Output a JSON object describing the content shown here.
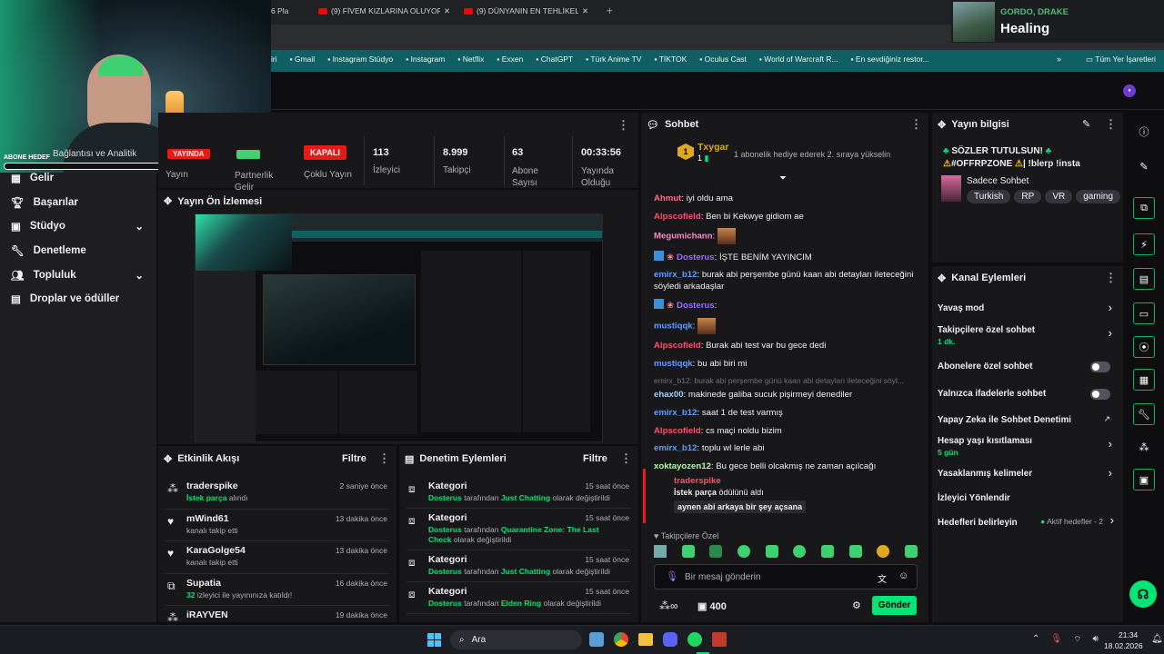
{
  "browser": {
    "tabs": [
      {
        "label": "6 Pla",
        "active": false
      },
      {
        "label": "(9) FİVEM KIZLARINA OLUYOR!",
        "active": false
      },
      {
        "label": "(9) DÜNYANIN EN TEHLİKELİ TE",
        "active": false
      }
    ],
    "bookmarks": [
      "Gmail",
      "Instagram Stüdyo",
      "Instagram",
      "Netflix",
      "Exxen",
      "ChatGPT",
      "Türk Anime TV",
      "TİKTOK",
      "Oculus Cast",
      "World of Warcraft R...",
      "En sevdiğiniz restor..."
    ],
    "bookmarks_truncated_first": "iri",
    "all_bookmarks": "Tüm Yer İşaretleri"
  },
  "music": {
    "artist": "GORDO, DRAKE",
    "title": "Healing"
  },
  "overlay": {
    "label": "ABONE HEDEF",
    "sidebar_partial": "Bağlantısı ve Analitik"
  },
  "sidebar": {
    "items": [
      {
        "label": "Gelir",
        "icon": "money-icon",
        "chevron": false
      },
      {
        "label": "Başarılar",
        "icon": "trophy-icon",
        "chevron": false
      },
      {
        "label": "Stüdyo",
        "icon": "studio-icon",
        "chevron": true
      },
      {
        "label": "Denetleme",
        "icon": "wrench-icon",
        "chevron": false
      },
      {
        "label": "Topluluk",
        "icon": "people-icon",
        "chevron": true
      },
      {
        "label": "Droplar ve ödüller",
        "icon": "gift-icon",
        "chevron": false
      }
    ]
  },
  "stats": {
    "labels": {
      "live": "Yayın",
      "partner": "Partnerlik Gelir",
      "multi": "Çoklu Yayın",
      "viewers": "İzleyici",
      "followers": "Takipçi",
      "subs": "Abone Sayısı",
      "uptime": "Yayında Olduğu"
    },
    "multi_badge": "KAPALI",
    "live_badge": "YAYINDA",
    "viewers": "113",
    "followers": "8.999",
    "subs": "63",
    "uptime": "00:33:56"
  },
  "preview": {
    "title": "Yayın Ön İzlemesi"
  },
  "activity": {
    "title": "Etkinlik Akışı",
    "filter": "Filtre",
    "items": [
      {
        "user": "traderspike",
        "highlight": "İstek parça",
        "text": " alındı",
        "time": "2 saniye önce",
        "icon": "reward-icon"
      },
      {
        "user": "mWind61",
        "highlight": "",
        "text": "kanalı takip etti",
        "time": "13 dakika önce",
        "icon": "heart-icon"
      },
      {
        "user": "KaraGolge54",
        "highlight": "",
        "text": "kanalı takip etti",
        "time": "13 dakika önce",
        "icon": "heart-icon"
      },
      {
        "user": "Supatia",
        "highlight": "32",
        "text": " izleyici ile yayınınıza katıldı!",
        "time": "16 dakika önce",
        "icon": "raid-icon"
      },
      {
        "user": "iRAYVEN",
        "highlight": "",
        "text": "",
        "time": "19 dakika önce",
        "icon": "reward-icon"
      }
    ]
  },
  "mod": {
    "title": "Denetim Eylemleri",
    "filter": "Filtre",
    "items": [
      {
        "label": "Kategori",
        "actor": "Dosterus",
        "mid": " tarafından ",
        "target": "Just Chatting",
        "end": " olarak değiştirildi",
        "time": "15 saat önce"
      },
      {
        "label": "Kategori",
        "actor": "Dosterus",
        "mid": " tarafından ",
        "target": "Quarantine Zone: The Last Check",
        "end": " olarak değiştirildi",
        "time": "15 saat önce"
      },
      {
        "label": "Kategori",
        "actor": "Dosterus",
        "mid": " tarafından ",
        "target": "Just Chatting",
        "end": " olarak değiştirildi",
        "time": "15 saat önce"
      },
      {
        "label": "Kategori",
        "actor": "Dosterus",
        "mid": " tarafından ",
        "target": "Elden Ring",
        "end": " olarak değiştirildi",
        "time": "15 saat önce"
      }
    ]
  },
  "chat": {
    "title": "Sohbet",
    "gift_user": "Txygar",
    "gift_count": "1",
    "gift_text": "1 abonelik hediye ederek 2. sıraya yükselin",
    "messages": [
      {
        "user": "Ahmut",
        "color": "#ff6b8a",
        "text": "iyi oldu ama",
        "badges": false
      },
      {
        "user": "Alpscofield",
        "color": "#ff4f6d",
        "text": "Ben bi Kekwye gidiom ae",
        "badges": false
      },
      {
        "user": "Megumichann",
        "color": "#ff88cc",
        "text": "",
        "badges": false,
        "emote": true
      },
      {
        "user": "Dosterus",
        "color": "#9b6bff",
        "text": "İŞTE BENİM YAYINCIM",
        "badges": true
      },
      {
        "user": "emirx_b12",
        "color": "#5aa0ff",
        "text": "burak abi perşembe günü kaan abi detayları ileteceğini söyledi arkadaşlar",
        "badges": false
      },
      {
        "user": "Dosterus",
        "color": "#9b6bff",
        "text": "",
        "badges": true
      },
      {
        "user": "mustiqqk",
        "color": "#5aa0ff",
        "text": "",
        "badges": false,
        "emote": true
      },
      {
        "user": "Alpscofield",
        "color": "#ff4f6d",
        "text": "Burak abi test var bu gece dedi",
        "badges": false
      },
      {
        "user": "mustiqqk",
        "color": "#5aa0ff",
        "text": "bu abi biri mi",
        "badges": false
      }
    ],
    "reply_hint": "emirx_b12: burak abi perşembe günü kaan abi detayları ileteceğini söyl...",
    "messages2": [
      {
        "user": "ehax00",
        "color": "#9ad0ff",
        "text": "makinede galiba sucuk pişirmeyi denediler"
      },
      {
        "user": "emirx_b12",
        "color": "#5aa0ff",
        "text": "saat 1 de test varmış"
      },
      {
        "user": "Alpscofield",
        "color": "#ff4f6d",
        "text": "cs maçi noldu bizim"
      },
      {
        "user": "emirx_b12",
        "color": "#5aa0ff",
        "text": "toplu wl lerle abi"
      },
      {
        "user": "xoktayozen12",
        "color": "#b0ff9e",
        "text": "Bu gece belli olcakmış ne zaman açılcağı"
      }
    ],
    "redeem": {
      "user": "traderspike",
      "reward": "İstek parça",
      "suffix": " ödülünü aldı",
      "message": "aynen abi arkaya bir şey açsana"
    },
    "followers_only": "Takipçilere Özel",
    "placeholder": "Bir mesaj gönderin",
    "points": "400",
    "send": "Gönder"
  },
  "stream_info": {
    "title": "Yayın bilgisi",
    "line1": "SÖZLER TUTULSUN!",
    "line2": "#OFFRPZONE",
    "line2b": "| !blerp !insta",
    "category": "Sadece Sohbet",
    "tags": [
      "Turkish",
      "RP",
      "VR",
      "gaming"
    ]
  },
  "channel_actions": {
    "title": "Kanal Eylemleri",
    "items": [
      {
        "label": "Yavaş mod",
        "sub": "",
        "ctrl": "chevron"
      },
      {
        "label": "Takipçilere özel sohbet",
        "sub": "1 dk.",
        "ctrl": "chevron"
      },
      {
        "label": "Abonelere özel sohbet",
        "sub": "",
        "ctrl": "toggle"
      },
      {
        "label": "Yalnızca ifadelerle sohbet",
        "sub": "",
        "ctrl": "toggle"
      },
      {
        "label": "Yapay Zeka ile Sohbet Denetimi",
        "sub": "",
        "ctrl": "external"
      },
      {
        "label": "Hesap yaşı kısıtlaması",
        "sub": "5 gün",
        "ctrl": "chevron"
      },
      {
        "label": "Yasaklanmış kelimeler",
        "sub": "",
        "ctrl": "chevron"
      },
      {
        "label": "İzleyici Yönlendir",
        "sub": "",
        "ctrl": "none"
      },
      {
        "label": "Hedefleri belirleyin",
        "sub": "",
        "ctrl": "goals"
      }
    ],
    "goals_text": "Aktif hedefler - 2"
  },
  "taskbar": {
    "search": "Ara",
    "time": "21:34",
    "date": "18.02.2026"
  }
}
